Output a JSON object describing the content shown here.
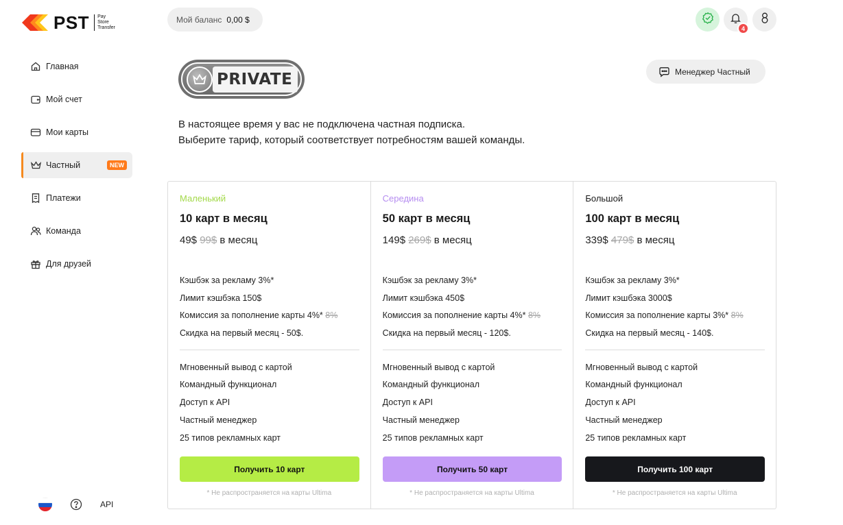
{
  "brand": {
    "logo_text": "PST",
    "logo_sub": [
      "Pay",
      "Store",
      "Transfer"
    ],
    "colors": {
      "accent": "#f58a1f",
      "logo_red": "#f0381c",
      "logo_orange": "#ff8a1d",
      "logo_yellow": "#ffc61a"
    }
  },
  "sidebar": {
    "items": [
      {
        "label": "Главная",
        "icon": "home-icon",
        "active": false
      },
      {
        "label": "Мой счет",
        "icon": "wallet-icon",
        "active": false
      },
      {
        "label": "Мои карты",
        "icon": "card-icon",
        "active": false
      },
      {
        "label": "Частный",
        "icon": "crown-icon",
        "active": true,
        "badge": "NEW"
      },
      {
        "label": "Платежи",
        "icon": "receipt-icon",
        "active": false
      },
      {
        "label": "Команда",
        "icon": "team-icon",
        "active": false
      },
      {
        "label": "Для друзей",
        "icon": "gift-icon",
        "active": false
      }
    ],
    "footer": {
      "language_icon": "russia-flag-icon",
      "help_icon": "help-icon",
      "api_label": "API"
    }
  },
  "header": {
    "balance_label": "Мой баланс",
    "balance_value": "0,00 $",
    "notifications_count": "4",
    "icons": [
      "verified-icon",
      "bell-icon",
      "user-icon"
    ]
  },
  "hero": {
    "badge_text": "PRIVATE",
    "manager_button": "Менеджер Частный",
    "intro_line1": "В настоящее время у вас не подключена частная подписка.",
    "intro_line2": "Выберите тариф, который соответствует потребностям вашей команды."
  },
  "plans": [
    {
      "name": "Маленький",
      "name_color": "#a3d94a",
      "title": "10 карт в месяц",
      "price": "49$",
      "old_price": "99$",
      "period": "в месяц",
      "cashback": "Кэшбэк за рекламу 3%*",
      "cashback_limit": "Лимит кэшбэка 150$",
      "topup_fee": "Комиссия за пополнение карты 4%*",
      "topup_fee_old": "8%",
      "first_month": "Скидка на первый месяц - 50$.",
      "features": [
        "Мгновенный вывод с картой",
        "Командный функционал",
        "Доступ к API",
        "Частный менеджер",
        "25 типов рекламных карт"
      ],
      "cta": "Получить 10 карт",
      "cta_color": "#b5ec45",
      "cta_text_color": "#111111",
      "note": "* Не распространяется на карты Ultima"
    },
    {
      "name": "Середина",
      "name_color": "#b58cf0",
      "title": "50 карт в месяц",
      "price": "149$",
      "old_price": "269$",
      "period": "в месяц",
      "cashback": "Кэшбэк за рекламу 3%*",
      "cashback_limit": "Лимит кэшбэка 450$",
      "topup_fee": "Комиссия за пополнение карты 4%*",
      "topup_fee_old": "8%",
      "first_month": "Скидка на первый месяц - 120$.",
      "features": [
        "Мгновенный вывод с картой",
        "Командный функционал",
        "Доступ к API",
        "Частный менеджер",
        "25 типов рекламных карт"
      ],
      "cta": "Получить 50 карт",
      "cta_color": "#c49cf7",
      "cta_text_color": "#111111",
      "note": "* Не распространяется на карты Ultima"
    },
    {
      "name": "Большой",
      "name_color": "#1a1a1a",
      "title": "100 карт в месяц",
      "price": "339$",
      "old_price": "479$",
      "period": "в месяц",
      "cashback": "Кэшбэк за рекламу 3%*",
      "cashback_limit": "Лимит кэшбэка 3000$",
      "topup_fee": "Комиссия за пополнение карты 3%*",
      "topup_fee_old": "8%",
      "first_month": "Скидка на первый месяц - 140$.",
      "features": [
        "Мгновенный вывод с картой",
        "Командный функционал",
        "Доступ к API",
        "Частный менеджер",
        "25 типов рекламных карт"
      ],
      "cta": "Получить 100 карт",
      "cta_color": "#17181c",
      "cta_text_color": "#ffffff",
      "note": "* Не распространяется на карты Ultima"
    }
  ]
}
